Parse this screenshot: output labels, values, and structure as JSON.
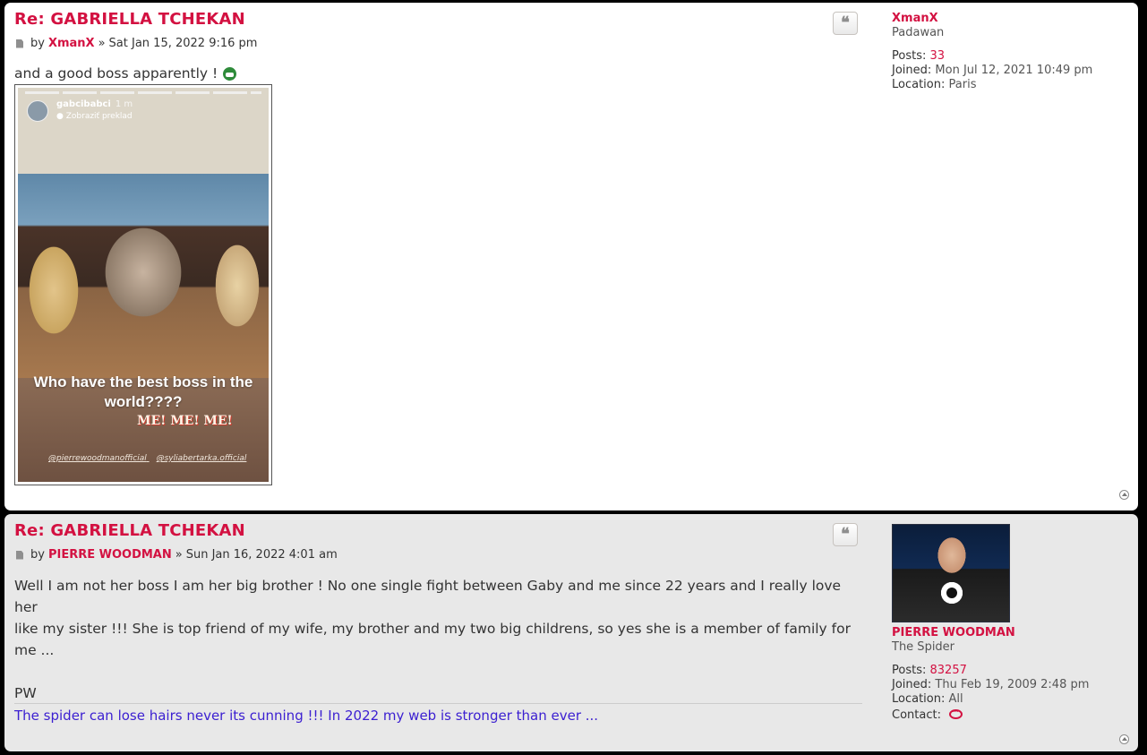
{
  "posts": [
    {
      "title": "Re: GABRIELLA TCHEKAN",
      "by_label": "by",
      "author": "XmanX",
      "date_sep": "»",
      "date": "Sat Jan 15, 2022 9:16 pm",
      "body": "and a good boss apparently !",
      "attachment": {
        "username": "gabcibabci",
        "time": "1 m",
        "translate": "Zobraziť preklad",
        "caption1": "Who have the best boss in the world????",
        "caption2": "ME! ME! ME!",
        "tag1": "@pierrewoodmanofficial",
        "tag2": "@syliabertarka.official"
      },
      "profile": {
        "name": "XmanX",
        "rank": "Padawan",
        "posts_label": "Posts:",
        "posts": "33",
        "joined_label": "Joined:",
        "joined": "Mon Jul 12, 2021 10:49 pm",
        "location_label": "Location:",
        "location": "Paris"
      }
    },
    {
      "title": "Re: GABRIELLA TCHEKAN",
      "by_label": "by",
      "author": "PIERRE WOODMAN",
      "date_sep": "»",
      "date": "Sun Jan 16, 2022 4:01 am",
      "body_line1": "Well I am not her boss I am her big brother ! No one single fight between Gaby and me since 22 years and I really love her",
      "body_line2": "like my sister !!! She is top friend of my wife, my brother and my two big childrens, so yes she is a member of family for",
      "body_line3": "me ...",
      "body_line4": "PW",
      "signature": "The spider can lose hairs never its cunning !!! In 2022 my web is stronger than ever ...",
      "profile": {
        "name": "PIERRE WOODMAN",
        "rank": "The Spider",
        "posts_label": "Posts:",
        "posts": "83257",
        "joined_label": "Joined:",
        "joined": "Thu Feb 19, 2009 2:48 pm",
        "location_label": "Location:",
        "location": "All",
        "contact_label": "Contact:"
      }
    }
  ],
  "icons": {
    "quote": "quote-icon",
    "post": "post-icon",
    "top": "back-to-top-icon",
    "contact": "contact-icon"
  },
  "colors": {
    "accent": "#d31141",
    "signature": "#3b1fd1",
    "post1_bg": "#ffffff",
    "post2_bg": "#e8e8e8"
  }
}
